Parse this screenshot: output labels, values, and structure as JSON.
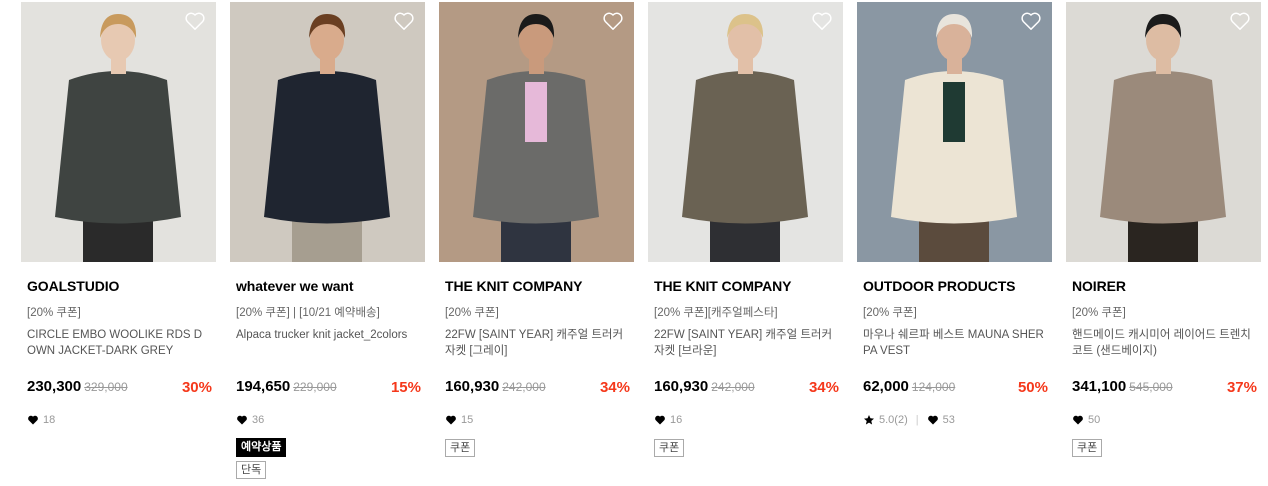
{
  "products": [
    {
      "brand": "GOALSTUDIO",
      "tags": "[20% 쿠폰]",
      "name": "CIRCLE EMBO WOOLIKE RDS DOWN JACKET-DARK GREY",
      "price": "230,300",
      "original_price": "329,000",
      "discount": "30%",
      "likes": "18",
      "colors": {
        "bg": "#e3e2de",
        "garment": "#3f4441",
        "hair": "#c89a5d",
        "skin": "#e7c9b2",
        "pants": "#2a2a2a"
      }
    },
    {
      "brand": "whatever we want",
      "tags": "[20% 쿠폰] | [10/21 예약배송]",
      "name": "Alpaca trucker knit jacket_2colors",
      "price": "194,650",
      "original_price": "229,000",
      "discount": "15%",
      "likes": "36",
      "badge_preorder": "예약상품",
      "badge_exclusive": "단독",
      "colors": {
        "bg": "#cfc9c0",
        "garment": "#1f2530",
        "hair": "#6a3f22",
        "skin": "#d9ab8c",
        "pants": "#a69e90"
      }
    },
    {
      "brand": "THE KNIT COMPANY",
      "tags": "[20% 쿠폰]",
      "name": "22FW [SAINT YEAR] 캐주얼 트러커 자켓 [그레이]",
      "price": "160,930",
      "original_price": "242,000",
      "discount": "34%",
      "likes": "15",
      "badge_coupon": "쿠폰",
      "colors": {
        "bg": "#b49a84",
        "garment": "#6b6b69",
        "hair": "#1a1a1a",
        "skin": "#c99a7c",
        "pants": "#2f3440",
        "inner": "#e6b9d9"
      }
    },
    {
      "brand": "THE KNIT COMPANY",
      "tags": "[20% 쿠폰][캐주얼페스타]",
      "name": "22FW [SAINT YEAR] 캐주얼 트러커 자켓 [브라운]",
      "price": "160,930",
      "original_price": "242,000",
      "discount": "34%",
      "likes": "16",
      "badge_coupon": "쿠폰",
      "colors": {
        "bg": "#e4e4e2",
        "garment": "#6a6253",
        "hair": "#dcc28a",
        "skin": "#e2c0a8",
        "pants": "#2e2f33"
      }
    },
    {
      "brand": "OUTDOOR PRODUCTS",
      "tags": "[20% 쿠폰]",
      "name": "마우나 쉐르파 베스트 MAUNA SHERPA VEST",
      "price": "62,000",
      "original_price": "124,000",
      "discount": "50%",
      "rating": "5.0(2)",
      "likes": "53",
      "colors": {
        "bg": "#8a97a3",
        "garment": "#ece4d4",
        "hair": "#e8e4dc",
        "skin": "#d9b29a",
        "pants": "#5b4b3d",
        "inner": "#1f3a33"
      }
    },
    {
      "brand": "NOIRER",
      "tags": "[20% 쿠폰]",
      "name": "핸드메이드 캐시미어 레이어드 트렌치 코트 (샌드베이지)",
      "price": "341,100",
      "original_price": "545,000",
      "discount": "37%",
      "likes": "50",
      "badge_coupon": "쿠폰",
      "colors": {
        "bg": "#dcdad5",
        "garment": "#9b8a7b",
        "hair": "#1b1b1b",
        "skin": "#ddbca3",
        "pants": "#2a2520"
      }
    }
  ]
}
